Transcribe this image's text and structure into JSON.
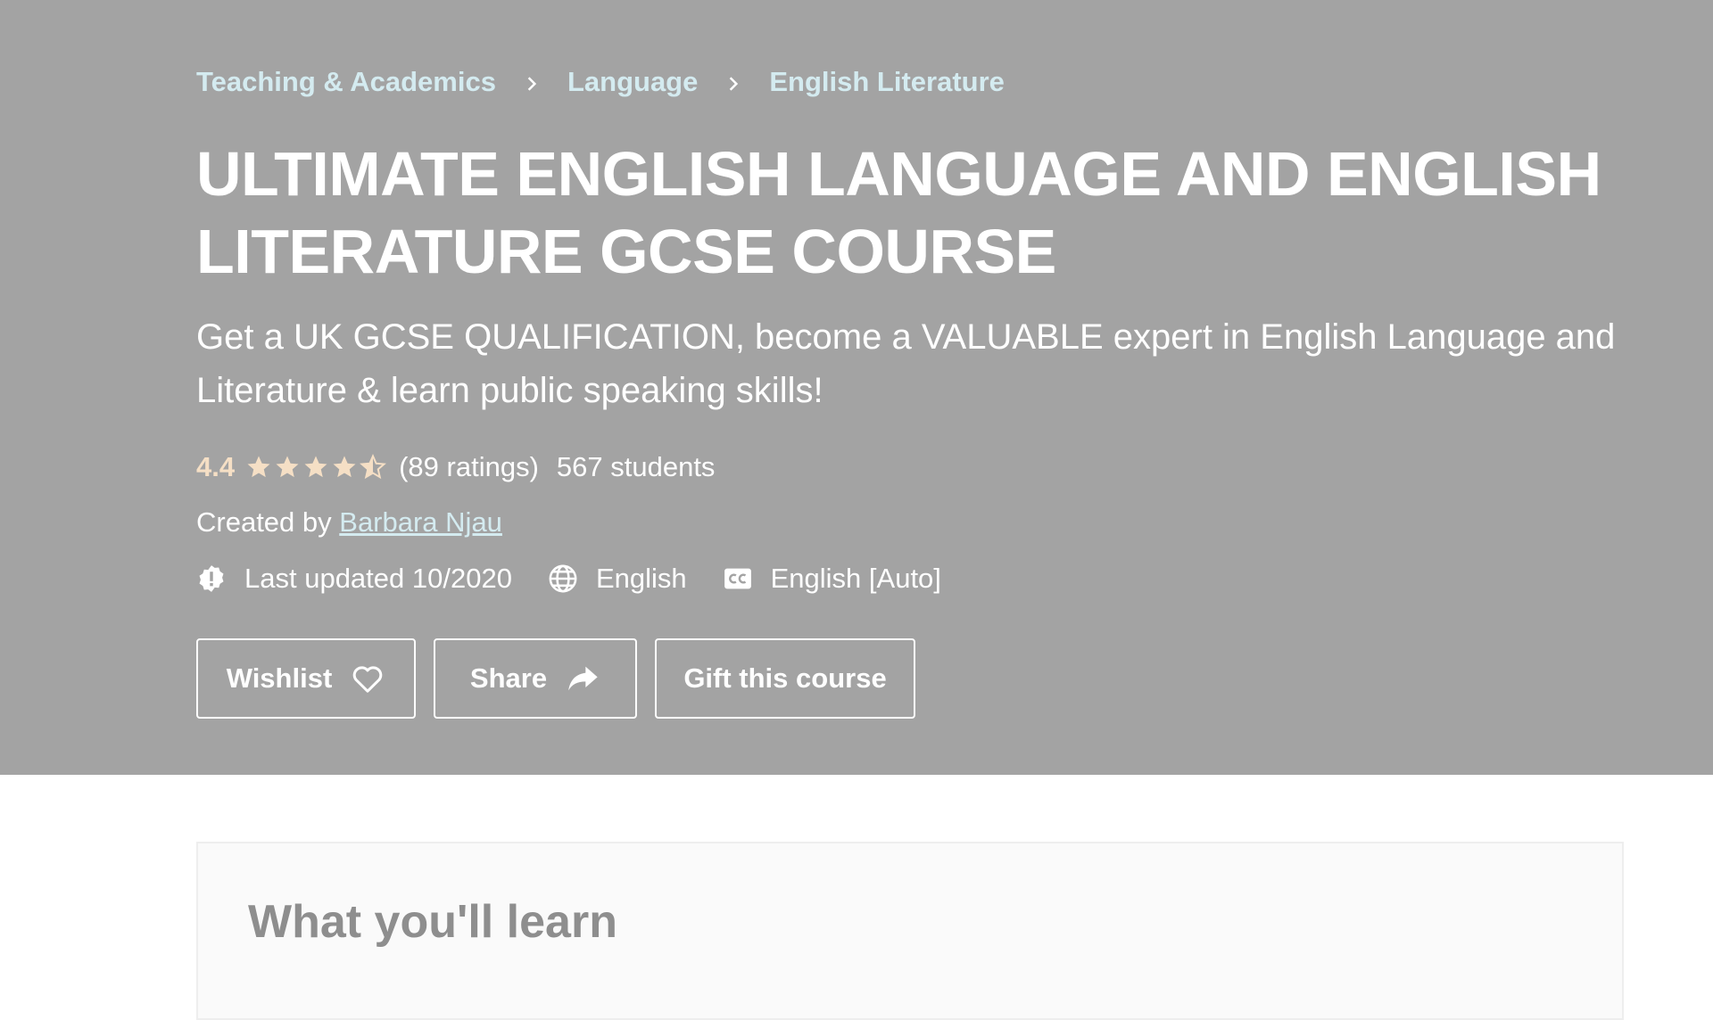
{
  "breadcrumb": {
    "items": [
      "Teaching & Academics",
      "Language",
      "English Literature"
    ]
  },
  "course": {
    "title": "ULTIMATE ENGLISH LANGUAGE AND ENGLISH LITERATURE GCSE COURSE",
    "subtitle": "Get a UK GCSE QUALIFICATION, become a VALUABLE expert in English Language and Literature & learn public speaking skills!",
    "rating": "4.4",
    "rating_stars": 4.4,
    "ratings_count": "(89 ratings)",
    "students": "567 students",
    "created_by_label": "Created by",
    "author": "Barbara Njau",
    "last_updated": "Last updated 10/2020",
    "language": "English",
    "captions": "English [Auto]"
  },
  "buttons": {
    "wishlist": "Wishlist",
    "share": "Share",
    "gift": "Gift this course"
  },
  "learn": {
    "title": "What you'll learn"
  },
  "icons": {
    "star": "star-icon",
    "half_star": "star-half-icon",
    "updated": "alert-badge-icon",
    "language": "globe-icon",
    "captions": "closed-captions-icon",
    "wishlist": "heart-icon",
    "share": "share-arrow-icon",
    "breadcrumb_sep": "chevron-right-icon"
  },
  "colors": {
    "hero_bg": "#a3a3a3",
    "link": "#d4ebf0",
    "rating": "#f5dfc5",
    "text": "#ffffff"
  }
}
